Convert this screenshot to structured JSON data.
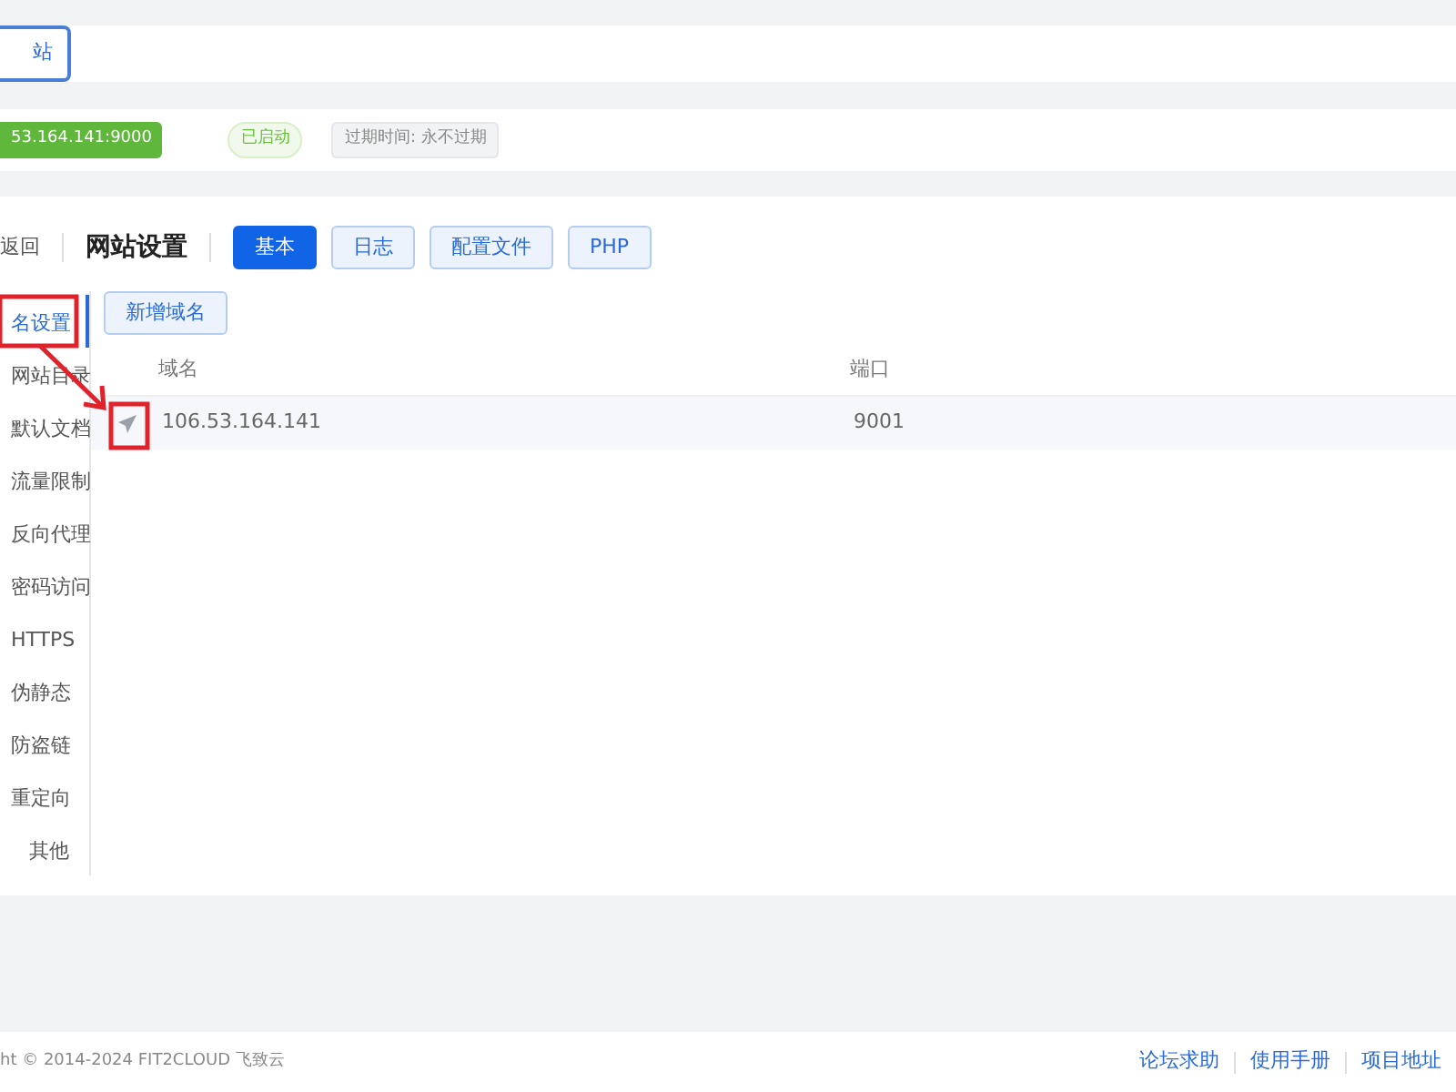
{
  "top_button": {
    "label": "站"
  },
  "status": {
    "address": "53.164.141:9000",
    "state": "已启动",
    "expiry": "过期时间: 永不过期"
  },
  "header": {
    "back": "返回",
    "title": "网站设置",
    "tabs": [
      {
        "label": "基本",
        "selected": true
      },
      {
        "label": "日志",
        "selected": false
      },
      {
        "label": "配置文件",
        "selected": false
      },
      {
        "label": "PHP",
        "selected": false
      }
    ]
  },
  "sidebar": {
    "items": [
      {
        "label": "名设置",
        "selected": true
      },
      {
        "label": "网站目录",
        "selected": false
      },
      {
        "label": "默认文档",
        "selected": false
      },
      {
        "label": "流量限制",
        "selected": false
      },
      {
        "label": "反向代理",
        "selected": false
      },
      {
        "label": "密码访问",
        "selected": false
      },
      {
        "label": "HTTPS",
        "selected": false
      },
      {
        "label": "伪静态",
        "selected": false
      },
      {
        "label": "防盗链",
        "selected": false
      },
      {
        "label": "重定向",
        "selected": false
      },
      {
        "label": "其他",
        "selected": false
      }
    ]
  },
  "add_button": "新增域名",
  "table": {
    "columns": [
      "域名",
      "端口"
    ],
    "rows": [
      {
        "domain": "106.53.164.141",
        "port": "9001"
      }
    ]
  },
  "footer": {
    "copyright": "ht © 2014-2024 FIT2CLOUD 飞致云",
    "links": [
      "论坛求助",
      "使用手册",
      "项目地址"
    ]
  }
}
